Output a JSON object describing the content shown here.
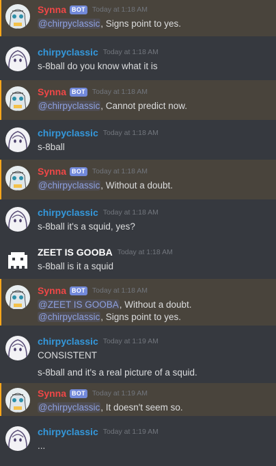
{
  "colors": {
    "background": "#36393f",
    "mention_highlight": "#49443c",
    "bot_name": "#f04747",
    "user_name": "#3498db",
    "zeet_name": "#ffffff",
    "bot_tag": "#7289da",
    "mention": "#8ea1e1",
    "timestamp": "#72767d",
    "text": "#dcddde"
  },
  "bot_tag_label": "BOT",
  "messages": [
    {
      "author": "Synna",
      "bot": true,
      "time": "Today at 1:18 AM",
      "mention": "@chirpyclassic",
      "rest": ", Signs point to yes."
    },
    {
      "author": "chirpyclassic",
      "bot": false,
      "time": "Today at 1:18 AM",
      "text": "s-8ball do you know what it is"
    },
    {
      "author": "Synna",
      "bot": true,
      "time": "Today at 1:18 AM",
      "mention": "@chirpyclassic",
      "rest": ", Cannot predict now."
    },
    {
      "author": "chirpyclassic",
      "bot": false,
      "time": "Today at 1:18 AM",
      "text": "s-8ball"
    },
    {
      "author": "Synna",
      "bot": true,
      "time": "Today at 1:18 AM",
      "mention": "@chirpyclassic",
      "rest": ", Without a doubt."
    },
    {
      "author": "chirpyclassic",
      "bot": false,
      "time": "Today at 1:18 AM",
      "text": "s-8ball it's a squid, yes?"
    },
    {
      "author": "ZEET IS GOOBA",
      "bot": false,
      "time": "Today at 1:18 AM",
      "text": "s-8ball is it a squid"
    },
    {
      "author": "Synna",
      "bot": true,
      "time": "Today at 1:18 AM",
      "mention": "@ZEET IS GOOBA",
      "rest": ", Without a doubt.",
      "followup_mention": "@chirpyclassic",
      "followup_rest": ", Signs point to yes."
    },
    {
      "author": "chirpyclassic",
      "bot": false,
      "time": "Today at 1:19 AM",
      "text": "CONSISTENT",
      "followup": "s-8ball and it's a real picture of a squid."
    },
    {
      "author": "Synna",
      "bot": true,
      "time": "Today at 1:19 AM",
      "mention": "@chirpyclassic",
      "rest": ", It doesn't seem so."
    },
    {
      "author": "chirpyclassic",
      "bot": false,
      "time": "Today at 1:19 AM",
      "text": "..."
    }
  ]
}
